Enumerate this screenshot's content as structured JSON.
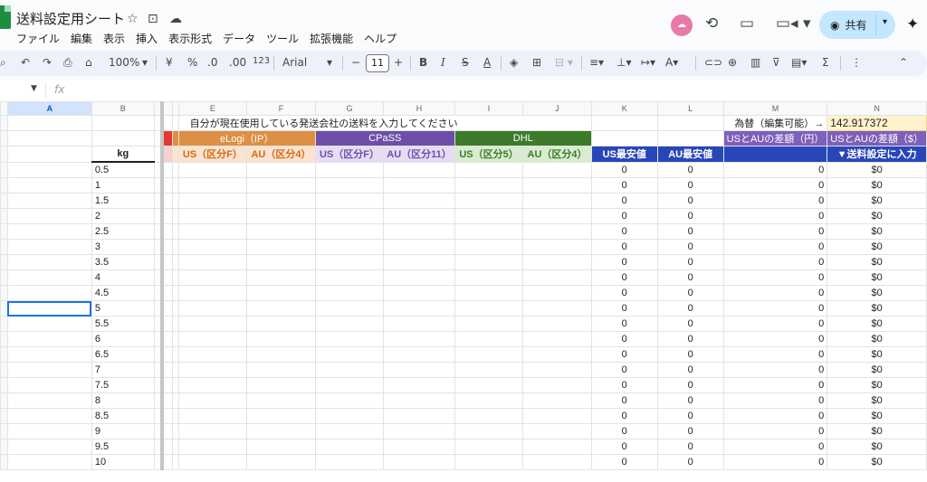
{
  "title": "送料設定用シート",
  "menu": [
    "ファイル",
    "編集",
    "表示",
    "挿入",
    "表示形式",
    "データ",
    "ツール",
    "拡張機能",
    "ヘルプ"
  ],
  "share_label": "共有",
  "toolbar": {
    "zoom": "100%",
    "currency": "¥",
    "percent": "%",
    "dec_decrease": ".0",
    "dec_increase": ".00",
    "number_format": "123",
    "font": "Arial",
    "font_size": "11",
    "minus": "−",
    "plus": "+",
    "bold": "B",
    "italic": "I",
    "strike": "S",
    "text_color": "A",
    "function": "Σ"
  },
  "formula_bar": {
    "fx": "fx"
  },
  "columns": [
    "A",
    "B",
    "E",
    "F",
    "G",
    "H",
    "I",
    "J",
    "K",
    "L",
    "M",
    "N"
  ],
  "sheet": {
    "instruction": "自分が現在使用している発送会社の送料を入力してください",
    "rate_label": "為替（編集可能）→",
    "rate_value": "142.917372",
    "carriers": [
      "eLogi（IP）",
      "CPaSS",
      "DHL"
    ],
    "diff_yen": "USとAUの差額（円）",
    "diff_usd": "USとAUの差額（$）",
    "kg_label": "kg",
    "sub_headers": [
      "US（区分F）",
      "AU（区分4）",
      "US（区分F）",
      "AU（区分11）",
      "US（区分5）",
      "AU（区分4）",
      "US最安値",
      "AU最安値",
      "",
      "▼送料設定に入力"
    ],
    "weights": [
      "0.5",
      "1",
      "1.5",
      "2",
      "2.5",
      "3",
      "3.5",
      "4",
      "4.5",
      "5",
      "5.5",
      "6",
      "6.5",
      "7",
      "7.5",
      "8",
      "8.5",
      "9",
      "9.5",
      "10"
    ],
    "zero": "0",
    "dollar_zero": "$0"
  }
}
